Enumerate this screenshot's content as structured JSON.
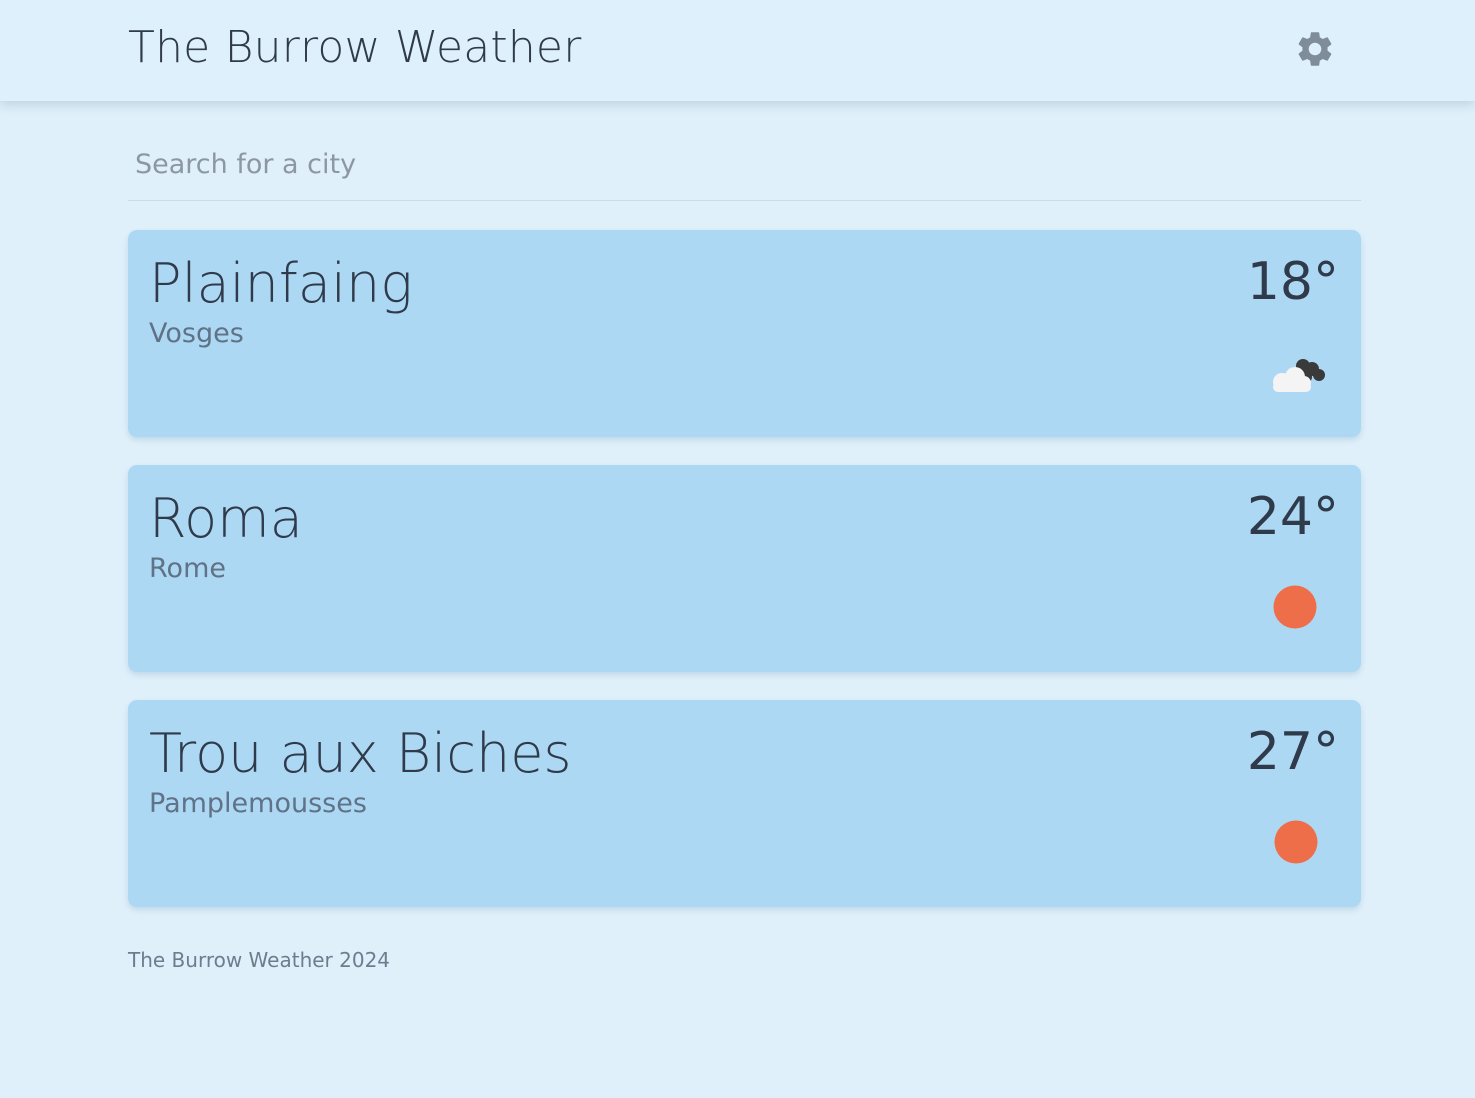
{
  "app": {
    "title": "The Burrow Weather",
    "settings_icon": "gear-icon"
  },
  "search": {
    "placeholder": "Search for a city",
    "value": ""
  },
  "cities": [
    {
      "name": "Plainfaing",
      "region": "Vosges",
      "temperature": "18°",
      "condition_icon": "partly-cloudy-icon"
    },
    {
      "name": "Roma",
      "region": "Rome",
      "temperature": "24°",
      "condition_icon": "sun-icon"
    },
    {
      "name": "Trou aux Biches",
      "region": "Pamplemousses",
      "temperature": "27°",
      "condition_icon": "sun-icon"
    }
  ],
  "footer": {
    "text": "The Burrow Weather 2024"
  },
  "colors": {
    "background": "#dff0fb",
    "card": "#add8f4",
    "sun": "#ee6e4a",
    "gear": "#7f8c99"
  }
}
